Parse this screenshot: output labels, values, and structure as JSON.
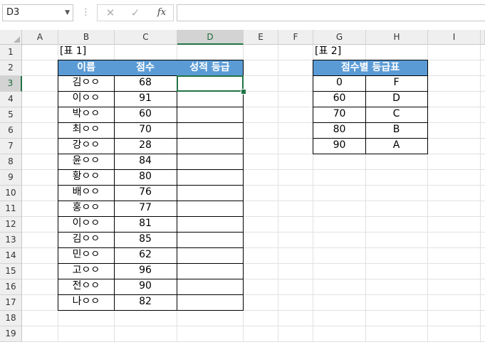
{
  "formula_bar": {
    "name_box": "D3",
    "cancel_icon": "✕",
    "enter_icon": "✓",
    "fx_label": "fx",
    "formula": ""
  },
  "columns": [
    "A",
    "B",
    "C",
    "D",
    "E",
    "F",
    "G",
    "H",
    "I"
  ],
  "rows": [
    "1",
    "2",
    "3",
    "4",
    "5",
    "6",
    "7",
    "8",
    "9",
    "10",
    "11",
    "12",
    "13",
    "14",
    "15",
    "16",
    "17",
    "18",
    "19"
  ],
  "selected_cell": {
    "column": "D",
    "row": "3"
  },
  "table1": {
    "caption": "[표 1]",
    "headers": [
      "이름",
      "점수",
      "성적 등급"
    ],
    "rows": [
      {
        "name": "김ㅇㅇ",
        "score": "68",
        "grade": ""
      },
      {
        "name": "이ㅇㅇ",
        "score": "91",
        "grade": ""
      },
      {
        "name": "박ㅇㅇ",
        "score": "60",
        "grade": ""
      },
      {
        "name": "최ㅇㅇ",
        "score": "70",
        "grade": ""
      },
      {
        "name": "강ㅇㅇ",
        "score": "28",
        "grade": ""
      },
      {
        "name": "윤ㅇㅇ",
        "score": "84",
        "grade": ""
      },
      {
        "name": "황ㅇㅇ",
        "score": "80",
        "grade": ""
      },
      {
        "name": "배ㅇㅇ",
        "score": "76",
        "grade": ""
      },
      {
        "name": "홍ㅇㅇ",
        "score": "77",
        "grade": ""
      },
      {
        "name": "이ㅇㅇ",
        "score": "81",
        "grade": ""
      },
      {
        "name": "김ㅇㅇ",
        "score": "85",
        "grade": ""
      },
      {
        "name": "민ㅇㅇ",
        "score": "62",
        "grade": ""
      },
      {
        "name": "고ㅇㅇ",
        "score": "96",
        "grade": ""
      },
      {
        "name": "전ㅇㅇ",
        "score": "90",
        "grade": ""
      },
      {
        "name": "나ㅇㅇ",
        "score": "82",
        "grade": ""
      }
    ]
  },
  "table2": {
    "caption": "[표 2]",
    "header": "점수별 등급표",
    "rows": [
      {
        "score": "0",
        "grade": "F"
      },
      {
        "score": "60",
        "grade": "D"
      },
      {
        "score": "70",
        "grade": "C"
      },
      {
        "score": "80",
        "grade": "B"
      },
      {
        "score": "90",
        "grade": "A"
      }
    ]
  },
  "colors": {
    "header_fill": "#5b9bd5",
    "selection": "#217346"
  }
}
